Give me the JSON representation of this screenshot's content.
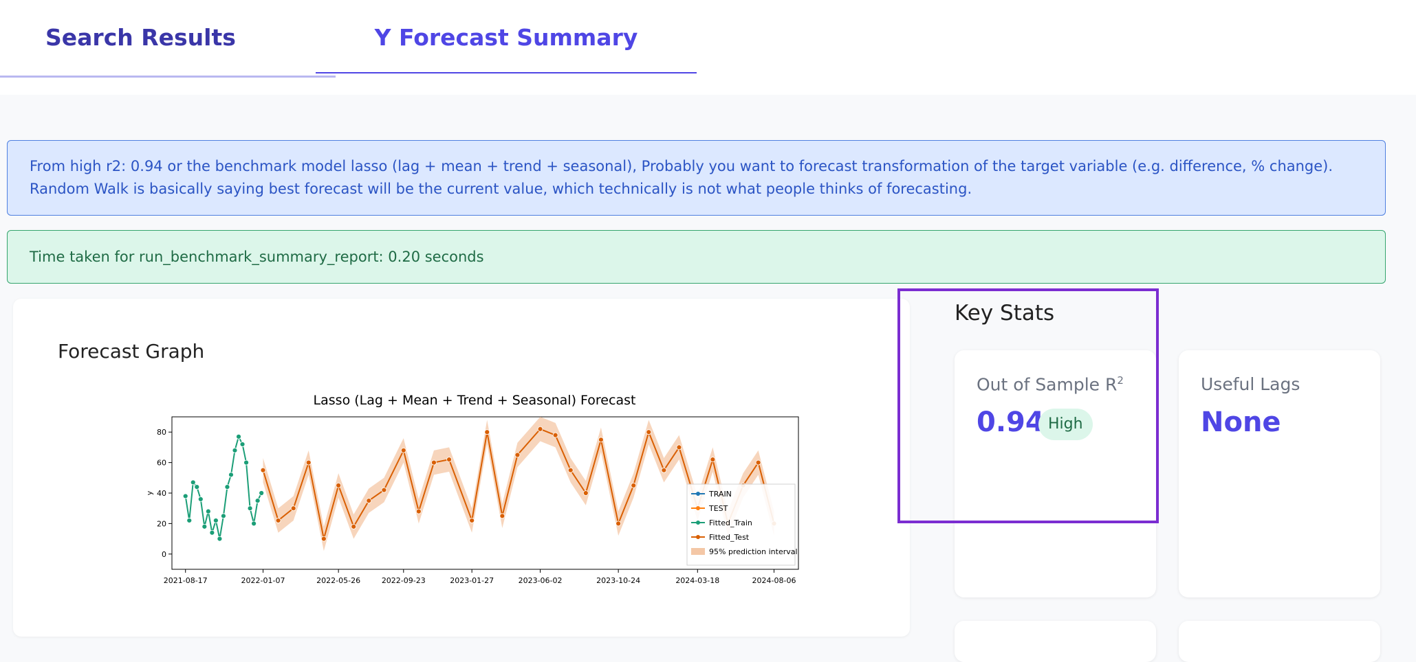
{
  "tabs": [
    {
      "label": "Search Results"
    },
    {
      "label": "Y Forecast Summary"
    }
  ],
  "alerts": {
    "info": "From high r2: 0.94 or the benchmark model lasso (lag + mean + trend + seasonal), Probably you want to forecast transformation of the target variable (e.g. difference, % change). Random Walk is basically saying best forecast will be the current value, which technically is not what people thinks of forecasting.",
    "success": "Time taken for run_benchmark_summary_report: 0.20 seconds"
  },
  "graph": {
    "card_title": "Forecast Graph"
  },
  "key_stats": {
    "title": "Key Stats",
    "r2_label": "Out of Sample R",
    "r2_sup": "2",
    "r2_value": "0.94",
    "r2_badge": "High",
    "lags_label": "Useful Lags",
    "lags_value": "None"
  },
  "colors": {
    "accent": "#4f46e5",
    "train": "#1f77b4",
    "test": "#ff7f0e",
    "fitted_train": "#1b9e77",
    "fitted_test": "#d95f02",
    "interval": "#f4c7a6",
    "highlight": "#7b2dd1"
  },
  "chart_data": {
    "type": "line",
    "title": "Lasso (Lag + Mean + Trend + Seasonal) Forecast",
    "xlabel": "",
    "ylabel": "y",
    "x_ticks": [
      "2021-08-17",
      "2022-01-07",
      "2022-05-26",
      "2022-09-23",
      "2023-01-27",
      "2023-06-02",
      "2023-10-24",
      "2024-03-18",
      "2024-08-06"
    ],
    "y_ticks": [
      0,
      20,
      40,
      60,
      80
    ],
    "ylim": [
      -10,
      90
    ],
    "legend_position": "lower right",
    "legend": [
      "TRAIN",
      "TEST",
      "Fitted_Train",
      "Fitted_Test",
      "95% prediction interval"
    ],
    "series": [
      {
        "name": "Fitted_Train",
        "x": [
          "2021-08-17",
          "2021-08-24",
          "2021-08-31",
          "2021-09-07",
          "2021-09-14",
          "2021-09-21",
          "2021-09-28",
          "2021-10-05",
          "2021-10-12",
          "2021-10-19",
          "2021-10-26",
          "2021-11-02",
          "2021-11-09",
          "2021-11-16",
          "2021-11-23",
          "2021-11-30",
          "2021-12-07",
          "2021-12-14",
          "2021-12-21",
          "2021-12-28",
          "2022-01-04"
        ],
        "values": [
          38,
          22,
          47,
          44,
          36,
          18,
          28,
          14,
          22,
          10,
          25,
          44,
          52,
          68,
          77,
          72,
          60,
          30,
          20,
          35,
          40
        ]
      },
      {
        "name": "Fitted_Test",
        "x": [
          "2022-01-07",
          "2022-02-04",
          "2022-03-04",
          "2022-04-01",
          "2022-04-29",
          "2022-05-26",
          "2022-06-23",
          "2022-07-21",
          "2022-08-18",
          "2022-09-23",
          "2022-10-21",
          "2022-11-18",
          "2022-12-16",
          "2023-01-27",
          "2023-02-24",
          "2023-03-24",
          "2023-04-21",
          "2023-06-02",
          "2023-06-30",
          "2023-07-28",
          "2023-08-25",
          "2023-09-22",
          "2023-10-24",
          "2023-11-21",
          "2023-12-19",
          "2024-01-16",
          "2024-02-13",
          "2024-03-18",
          "2024-04-15",
          "2024-05-13",
          "2024-06-10",
          "2024-07-08",
          "2024-08-06"
        ],
        "values": [
          55,
          22,
          30,
          60,
          10,
          45,
          18,
          35,
          42,
          68,
          28,
          60,
          62,
          22,
          80,
          25,
          65,
          82,
          78,
          55,
          40,
          75,
          20,
          45,
          80,
          55,
          70,
          30,
          62,
          20,
          45,
          60,
          20
        ]
      }
    ]
  }
}
